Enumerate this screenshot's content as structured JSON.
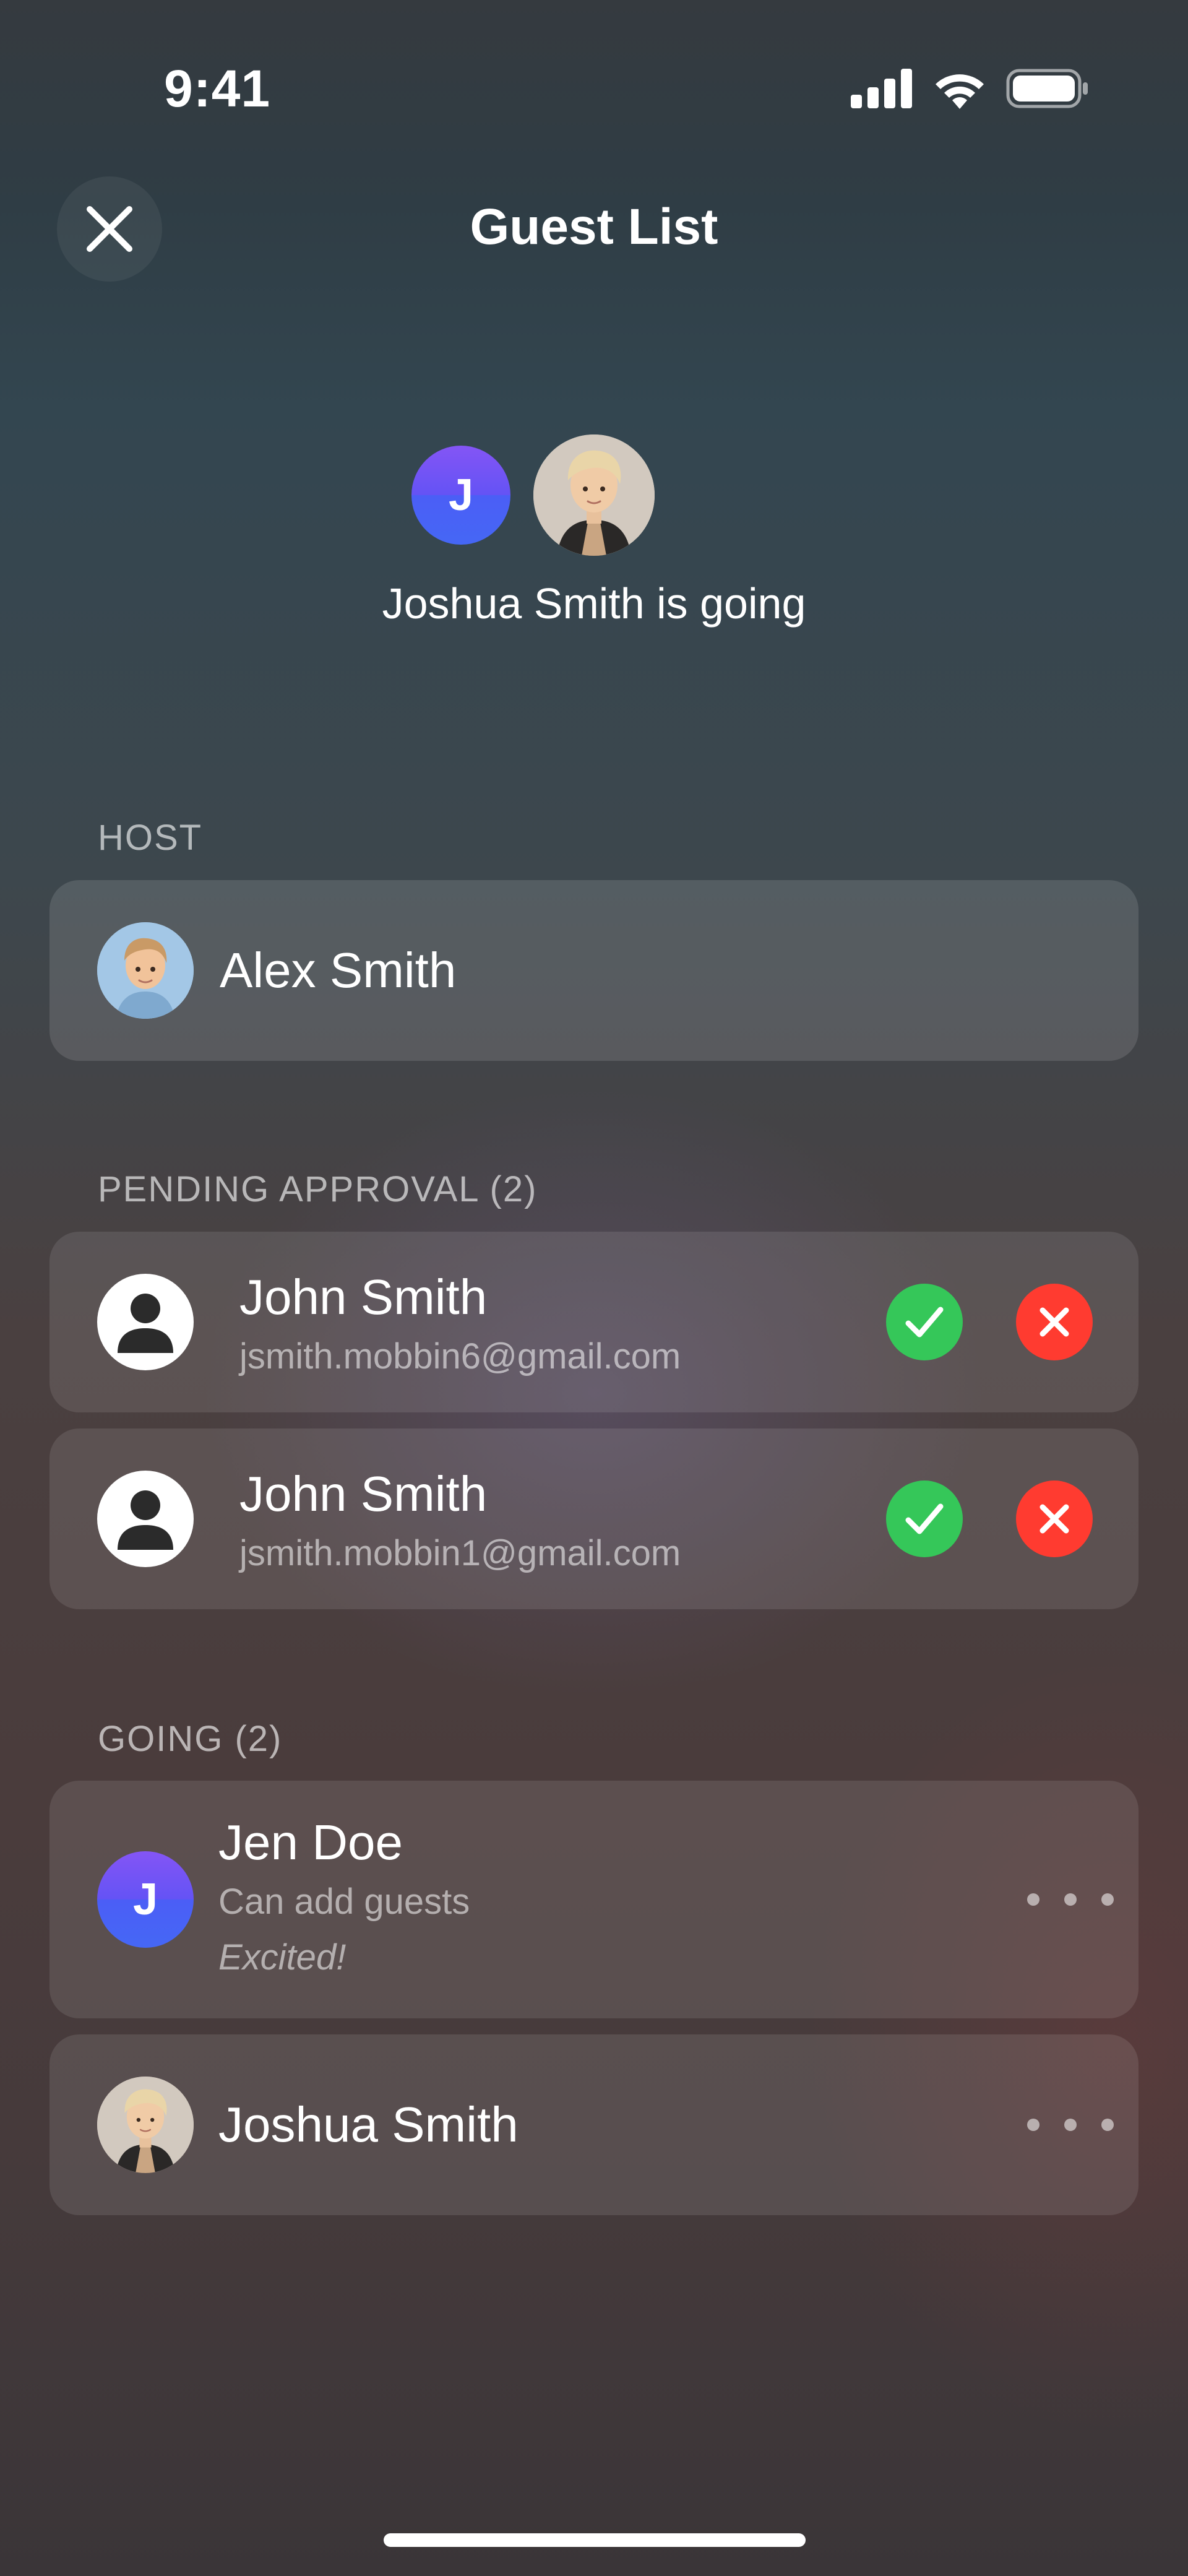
{
  "status_bar": {
    "time": "9:41"
  },
  "header": {
    "title": "Guest List"
  },
  "summary": {
    "initial": "J",
    "text": "Joshua Smith is going"
  },
  "host": {
    "section_label": "HOST",
    "name": "Alex Smith"
  },
  "pending": {
    "section_label": "PENDING APPROVAL (2)",
    "items": [
      {
        "name": "John Smith",
        "email": "jsmith.mobbin6@gmail.com"
      },
      {
        "name": "John Smith",
        "email": "jsmith.mobbin1@gmail.com"
      }
    ]
  },
  "going": {
    "section_label": "GOING (2)",
    "items": [
      {
        "initial": "J",
        "name": "Jen Doe",
        "subtitle": "Can add guests",
        "note": "Excited!"
      },
      {
        "name": "Joshua Smith"
      }
    ]
  },
  "colors": {
    "approve": "#35c759",
    "decline": "#ff3b30",
    "avatar_purple": "#6453f5"
  },
  "icons": [
    "signal-icon",
    "wifi-icon",
    "battery-icon",
    "close-icon",
    "person-icon",
    "checkmark-icon",
    "x-icon",
    "more-icon"
  ]
}
